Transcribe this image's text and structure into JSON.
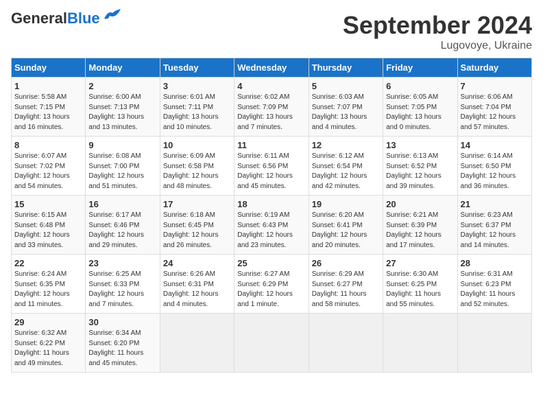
{
  "header": {
    "logo_general": "General",
    "logo_blue": "Blue",
    "month_title": "September 2024",
    "location": "Lugovoye, Ukraine"
  },
  "days_of_week": [
    "Sunday",
    "Monday",
    "Tuesday",
    "Wednesday",
    "Thursday",
    "Friday",
    "Saturday"
  ],
  "weeks": [
    [
      {
        "day": "1",
        "content": "Sunrise: 5:58 AM\nSunset: 7:15 PM\nDaylight: 13 hours\nand 16 minutes."
      },
      {
        "day": "2",
        "content": "Sunrise: 6:00 AM\nSunset: 7:13 PM\nDaylight: 13 hours\nand 13 minutes."
      },
      {
        "day": "3",
        "content": "Sunrise: 6:01 AM\nSunset: 7:11 PM\nDaylight: 13 hours\nand 10 minutes."
      },
      {
        "day": "4",
        "content": "Sunrise: 6:02 AM\nSunset: 7:09 PM\nDaylight: 13 hours\nand 7 minutes."
      },
      {
        "day": "5",
        "content": "Sunrise: 6:03 AM\nSunset: 7:07 PM\nDaylight: 13 hours\nand 4 minutes."
      },
      {
        "day": "6",
        "content": "Sunrise: 6:05 AM\nSunset: 7:05 PM\nDaylight: 13 hours\nand 0 minutes."
      },
      {
        "day": "7",
        "content": "Sunrise: 6:06 AM\nSunset: 7:04 PM\nDaylight: 12 hours\nand 57 minutes."
      }
    ],
    [
      {
        "day": "8",
        "content": "Sunrise: 6:07 AM\nSunset: 7:02 PM\nDaylight: 12 hours\nand 54 minutes."
      },
      {
        "day": "9",
        "content": "Sunrise: 6:08 AM\nSunset: 7:00 PM\nDaylight: 12 hours\nand 51 minutes."
      },
      {
        "day": "10",
        "content": "Sunrise: 6:09 AM\nSunset: 6:58 PM\nDaylight: 12 hours\nand 48 minutes."
      },
      {
        "day": "11",
        "content": "Sunrise: 6:11 AM\nSunset: 6:56 PM\nDaylight: 12 hours\nand 45 minutes."
      },
      {
        "day": "12",
        "content": "Sunrise: 6:12 AM\nSunset: 6:54 PM\nDaylight: 12 hours\nand 42 minutes."
      },
      {
        "day": "13",
        "content": "Sunrise: 6:13 AM\nSunset: 6:52 PM\nDaylight: 12 hours\nand 39 minutes."
      },
      {
        "day": "14",
        "content": "Sunrise: 6:14 AM\nSunset: 6:50 PM\nDaylight: 12 hours\nand 36 minutes."
      }
    ],
    [
      {
        "day": "15",
        "content": "Sunrise: 6:15 AM\nSunset: 6:48 PM\nDaylight: 12 hours\nand 33 minutes."
      },
      {
        "day": "16",
        "content": "Sunrise: 6:17 AM\nSunset: 6:46 PM\nDaylight: 12 hours\nand 29 minutes."
      },
      {
        "day": "17",
        "content": "Sunrise: 6:18 AM\nSunset: 6:45 PM\nDaylight: 12 hours\nand 26 minutes."
      },
      {
        "day": "18",
        "content": "Sunrise: 6:19 AM\nSunset: 6:43 PM\nDaylight: 12 hours\nand 23 minutes."
      },
      {
        "day": "19",
        "content": "Sunrise: 6:20 AM\nSunset: 6:41 PM\nDaylight: 12 hours\nand 20 minutes."
      },
      {
        "day": "20",
        "content": "Sunrise: 6:21 AM\nSunset: 6:39 PM\nDaylight: 12 hours\nand 17 minutes."
      },
      {
        "day": "21",
        "content": "Sunrise: 6:23 AM\nSunset: 6:37 PM\nDaylight: 12 hours\nand 14 minutes."
      }
    ],
    [
      {
        "day": "22",
        "content": "Sunrise: 6:24 AM\nSunset: 6:35 PM\nDaylight: 12 hours\nand 11 minutes."
      },
      {
        "day": "23",
        "content": "Sunrise: 6:25 AM\nSunset: 6:33 PM\nDaylight: 12 hours\nand 7 minutes."
      },
      {
        "day": "24",
        "content": "Sunrise: 6:26 AM\nSunset: 6:31 PM\nDaylight: 12 hours\nand 4 minutes."
      },
      {
        "day": "25",
        "content": "Sunrise: 6:27 AM\nSunset: 6:29 PM\nDaylight: 12 hours\nand 1 minute."
      },
      {
        "day": "26",
        "content": "Sunrise: 6:29 AM\nSunset: 6:27 PM\nDaylight: 11 hours\nand 58 minutes."
      },
      {
        "day": "27",
        "content": "Sunrise: 6:30 AM\nSunset: 6:25 PM\nDaylight: 11 hours\nand 55 minutes."
      },
      {
        "day": "28",
        "content": "Sunrise: 6:31 AM\nSunset: 6:23 PM\nDaylight: 11 hours\nand 52 minutes."
      }
    ],
    [
      {
        "day": "29",
        "content": "Sunrise: 6:32 AM\nSunset: 6:22 PM\nDaylight: 11 hours\nand 49 minutes."
      },
      {
        "day": "30",
        "content": "Sunrise: 6:34 AM\nSunset: 6:20 PM\nDaylight: 11 hours\nand 45 minutes."
      },
      {
        "day": "",
        "content": ""
      },
      {
        "day": "",
        "content": ""
      },
      {
        "day": "",
        "content": ""
      },
      {
        "day": "",
        "content": ""
      },
      {
        "day": "",
        "content": ""
      }
    ]
  ]
}
